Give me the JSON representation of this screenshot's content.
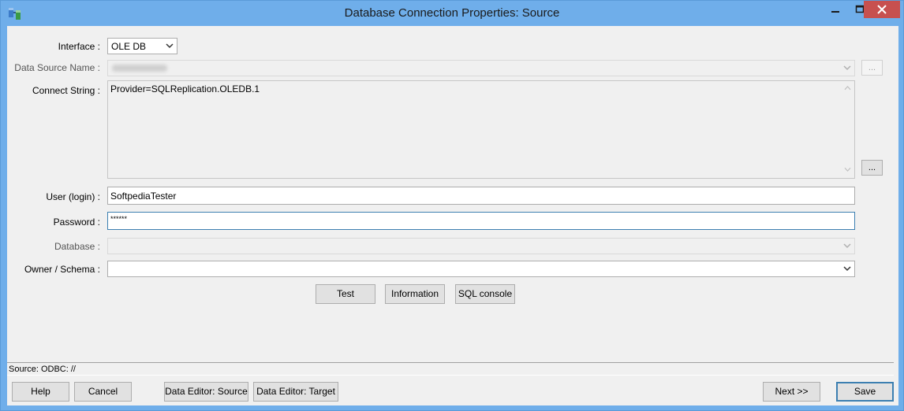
{
  "window": {
    "title": "Database Connection Properties: Source"
  },
  "form": {
    "interface": {
      "label": "Interface :",
      "value": "OLE DB"
    },
    "data_source_name": {
      "label": "Data Source Name :",
      "browse_label": "..."
    },
    "connect_string": {
      "label": "Connect String :",
      "value": "Provider=SQLReplication.OLEDB.1",
      "browse_label": "..."
    },
    "user": {
      "label": "User (login) :",
      "value": "SoftpediaTester"
    },
    "password": {
      "label": "Password :",
      "value": "******"
    },
    "database": {
      "label": "Database :",
      "value": ""
    },
    "owner_schema": {
      "label": "Owner / Schema :",
      "value": ""
    }
  },
  "actions": {
    "test": "Test",
    "information": "Information",
    "sql_console": "SQL console"
  },
  "status": {
    "text": "Source: ODBC: //"
  },
  "footer": {
    "help": "Help",
    "cancel": "Cancel",
    "data_editor_source": "Data Editor: Source",
    "data_editor_target": "Data Editor: Target",
    "next": "Next >>",
    "save": "Save"
  },
  "colors": {
    "title_bar": "#6faeea",
    "close_button": "#c7504f",
    "dialog_bg": "#f0f0f0",
    "focus_border": "#3c7fb1"
  },
  "icons": [
    "app-icon",
    "minimize-icon",
    "maximize-icon",
    "close-icon",
    "chevron-down-icon",
    "scroll-up-icon",
    "scroll-down-icon"
  ]
}
